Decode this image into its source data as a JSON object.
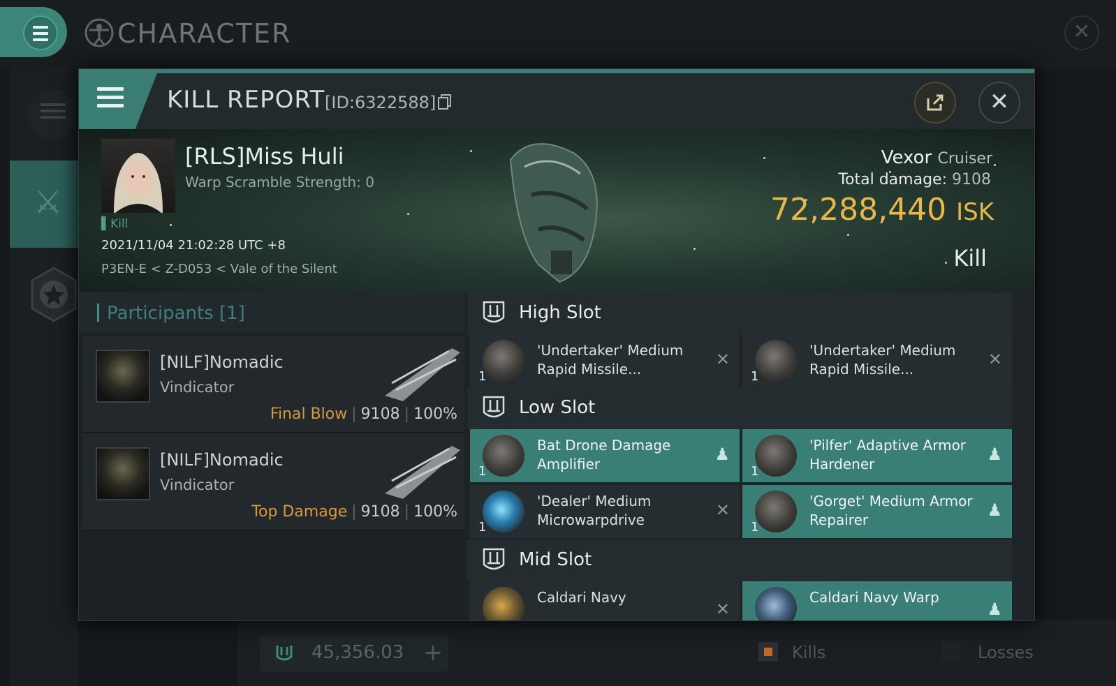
{
  "window": {
    "title": "CHARACTER"
  },
  "bottom": {
    "isk_value": "45,356.03",
    "plus_label": "+",
    "kills_label": "Kills",
    "losses_label": "Losses"
  },
  "kill_report": {
    "title": "KILL REPORT",
    "id_label": "[ID:6322588]",
    "victim": {
      "name": "[RLS]Miss Huli",
      "warp_scramble": "Warp Scramble Strength: 0",
      "kill_tag": "Kill",
      "datetime": "2021/11/04 21:02:28 UTC +8",
      "location": "P3EN-E < Z-D053 < Vale of the Silent"
    },
    "ship": {
      "name": "Vexor",
      "class": "Cruiser",
      "total_damage_label": "Total damage:",
      "total_damage": "9108",
      "isk_value": "72,288,440",
      "isk_unit": "ISK",
      "result": "Kill"
    },
    "participants": {
      "title": "Participants",
      "count": "[1]",
      "rows": [
        {
          "name": "[NILF]Nomadic",
          "ship": "Vindicator",
          "tag": "Final Blow",
          "damage": "9108",
          "percent": "100%"
        },
        {
          "name": "[NILF]Nomadic",
          "ship": "Vindicator",
          "tag": "Top Damage",
          "damage": "9108",
          "percent": "100%"
        }
      ]
    },
    "slots": {
      "high": {
        "title": "High Slot",
        "modules": [
          {
            "name": "'Undertaker' Medium Rapid Missile...",
            "qty": "1",
            "status": "destroyed"
          },
          {
            "name": "'Undertaker' Medium Rapid Missile...",
            "qty": "1",
            "status": "destroyed"
          }
        ]
      },
      "low": {
        "title": "Low Slot",
        "modules": [
          {
            "name": "Bat Drone Damage Amplifier",
            "qty": "1",
            "status": "dropped"
          },
          {
            "name": "'Pilfer' Adaptive Armor Hardener",
            "qty": "1",
            "status": "dropped"
          },
          {
            "name": "'Dealer' Medium Microwarpdrive",
            "qty": "1",
            "status": "destroyed"
          },
          {
            "name": "'Gorget' Medium Armor Repairer",
            "qty": "1",
            "status": "dropped"
          }
        ]
      },
      "mid": {
        "title": "Mid Slot",
        "modules": [
          {
            "name": "Caldari Navy",
            "qty": "",
            "status": "destroyed"
          },
          {
            "name": "Caldari Navy Warp",
            "qty": "",
            "status": "dropped"
          }
        ]
      }
    }
  },
  "colors": {
    "accent": "#3a7f75",
    "isk_gold": "#e9b84a",
    "final_blow": "#d49a3e"
  },
  "icons": [
    "menu-icon",
    "character-icon",
    "close-icon",
    "swords-icon",
    "star-icon",
    "copy-icon",
    "share-icon",
    "slot-icon",
    "destroyed-icon",
    "dropped-icon",
    "isk-icon"
  ]
}
